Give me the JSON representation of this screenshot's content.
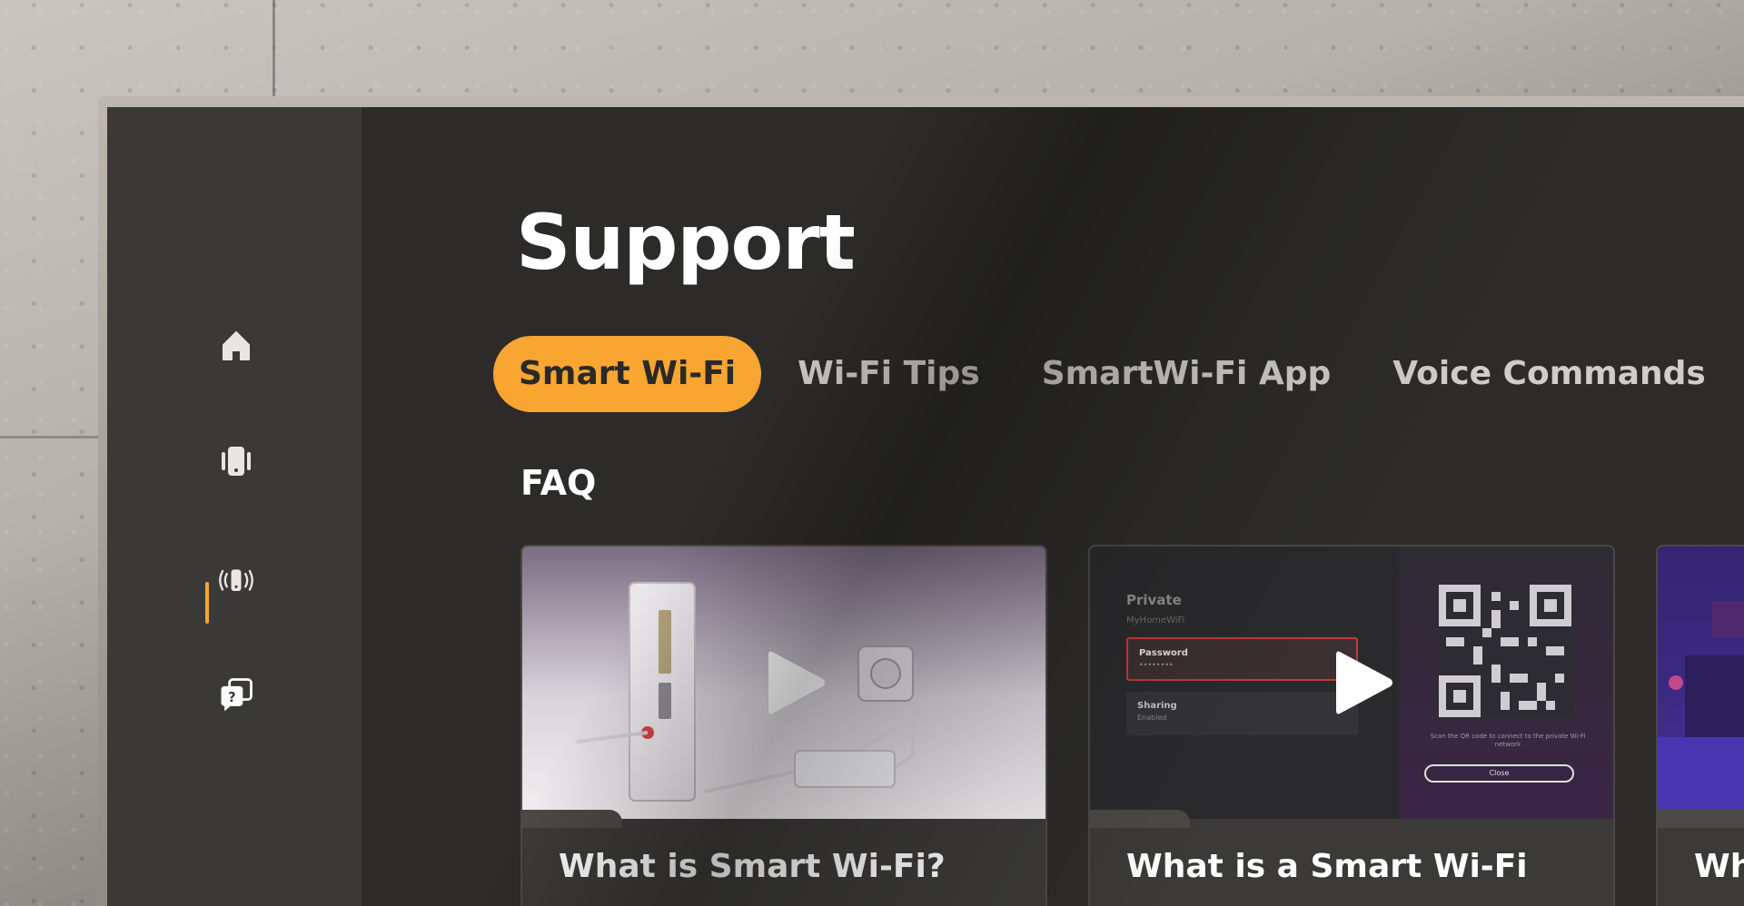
{
  "sidebar": {
    "items": [
      {
        "name": "home",
        "icon": "home-icon",
        "active": false
      },
      {
        "name": "devices",
        "icon": "device-icon",
        "active": false
      },
      {
        "name": "network",
        "icon": "router-signal-icon",
        "active": false
      },
      {
        "name": "support",
        "icon": "support-chat-icon",
        "active": true
      }
    ],
    "accent": "#f8a531"
  },
  "page": {
    "title": "Support"
  },
  "tabs": [
    {
      "label": "Smart Wi-Fi",
      "active": true
    },
    {
      "label": "Wi-Fi Tips",
      "active": false
    },
    {
      "label": "SmartWi-Fi App",
      "active": false
    },
    {
      "label": "Voice Commands",
      "active": false
    }
  ],
  "faq": {
    "section_title": "FAQ",
    "cards": [
      {
        "title": "What is Smart Wi-Fi?",
        "thumbnail": "router-plugged-in-image"
      },
      {
        "title": "What is a Smart Wi-Fi",
        "thumbnail": "qr-share-screen-image",
        "screen": {
          "network_label": "Private",
          "network_name": "MyHomeWiFi",
          "password_label": "Password",
          "password_value": "••••••••",
          "sharing_label": "Sharing",
          "sharing_value": "Enabled",
          "qr_caption": "Scan the QR code to connect to the private Wi-Fi network",
          "close_label": "Close"
        }
      },
      {
        "title": "What ar",
        "thumbnail": "living-room-image"
      }
    ]
  },
  "colors": {
    "screen_bg": "#2c2b29",
    "sidebar_bg": "#3a3937",
    "accent": "#f8a531",
    "text": "#ffffff",
    "tab_text": "#cfcdca"
  }
}
